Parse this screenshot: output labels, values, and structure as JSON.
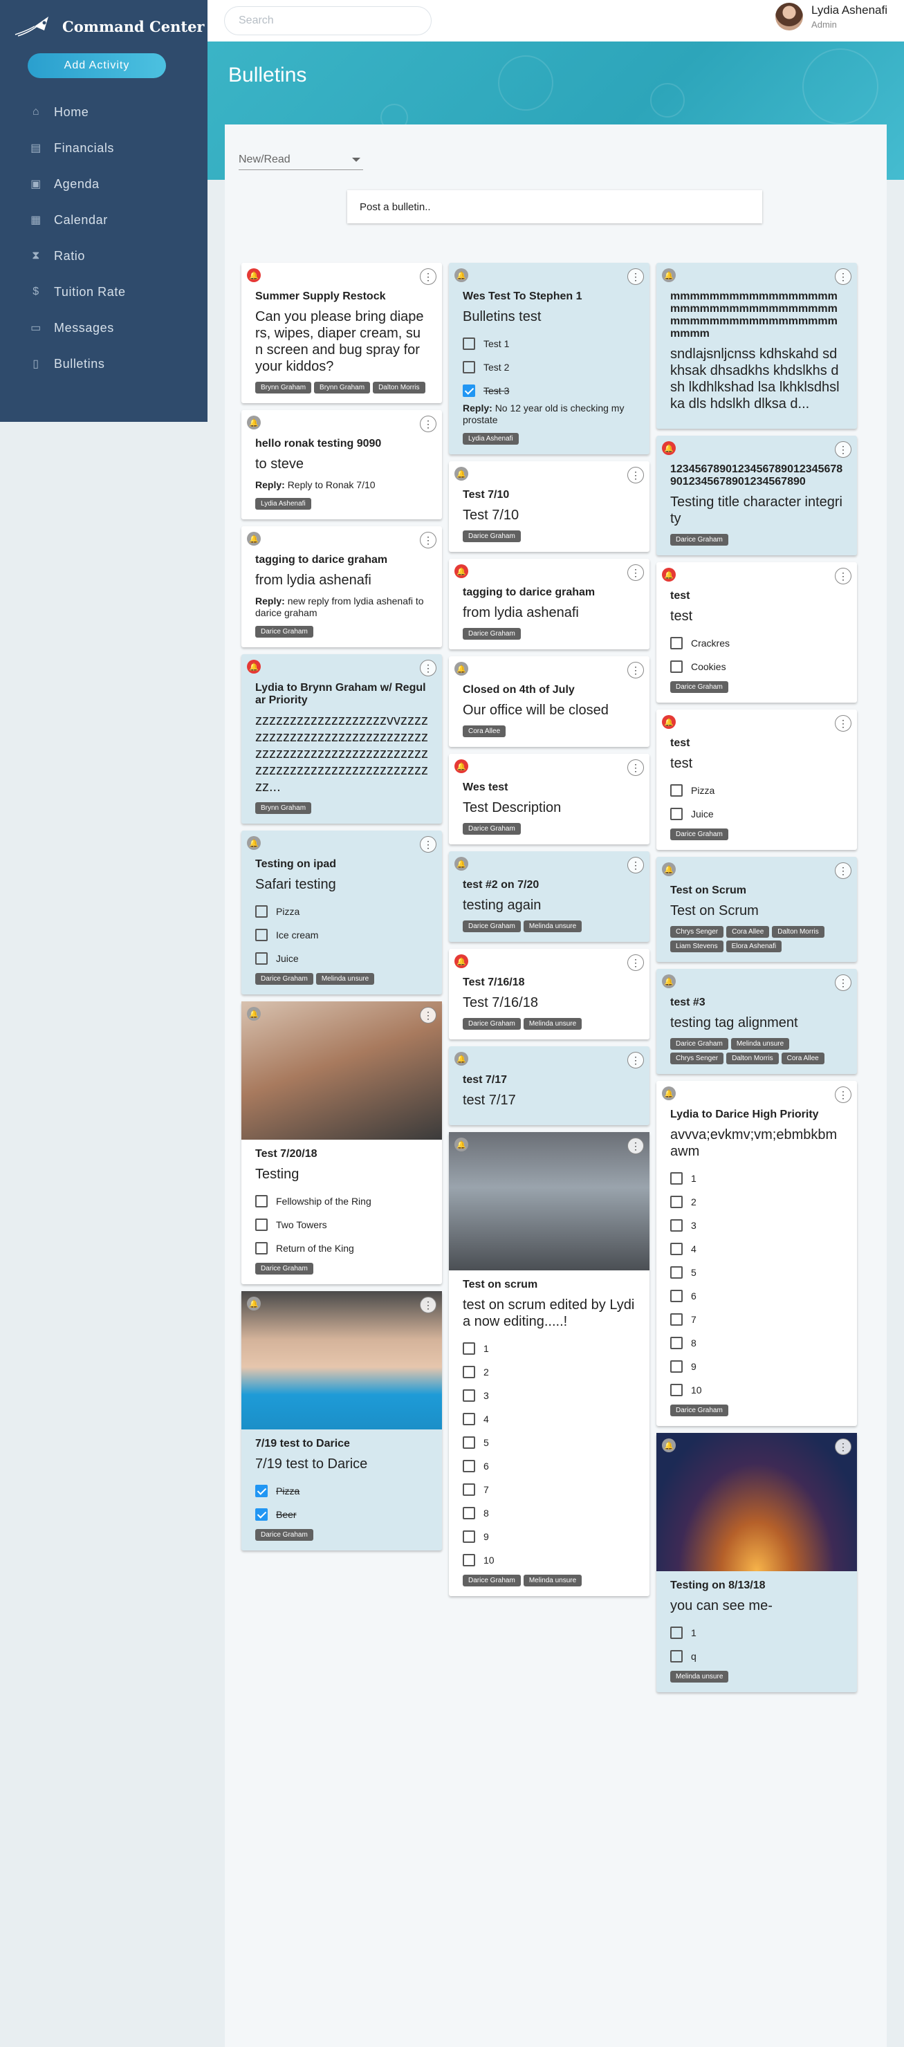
{
  "sidebar": {
    "brand": "Command Center",
    "add_activity": "Add Activity",
    "items": [
      {
        "label": "Home",
        "icon": "bank-icon"
      },
      {
        "label": "Financials",
        "icon": "chart-icon"
      },
      {
        "label": "Agenda",
        "icon": "camera-icon"
      },
      {
        "label": "Calendar",
        "icon": "calendar-icon"
      },
      {
        "label": "Ratio",
        "icon": "hourglass-icon"
      },
      {
        "label": "Tuition Rate",
        "icon": "dollar-icon"
      },
      {
        "label": "Messages",
        "icon": "message-icon"
      },
      {
        "label": "Bulletins",
        "icon": "document-icon"
      }
    ]
  },
  "topbar": {
    "search_placeholder": "Search",
    "user_name": "Lydia Ashenafi",
    "user_role": "Admin"
  },
  "page": {
    "title": "Bulletins",
    "filter": "New/Read",
    "post_placeholder": "Post a bulletin.."
  },
  "col1": [
    {
      "bell": "red",
      "title": "Summer Supply Restock",
      "desc": "Can you please bring diapers, wipes, diaper cream, sun screen and bug spray for your kiddos?",
      "tags": [
        "Brynn Graham",
        "Brynn Graham",
        "Dalton Morris"
      ]
    },
    {
      "bell": "grey",
      "title": "hello ronak testing 9090",
      "desc": "to steve",
      "reply_label": "Reply:",
      "reply": "Reply to Ronak 7/10",
      "tags": [
        "Lydia Ashenafi"
      ]
    },
    {
      "bell": "grey",
      "title": "tagging to darice graham",
      "desc": "from lydia ashenafi",
      "reply_label": "Reply:",
      "reply": "new reply from lydia ashenafi to darice graham",
      "tags": [
        "Darice Graham"
      ]
    },
    {
      "bell": "red",
      "blue": true,
      "title": "Lydia to Brynn Graham w/ Regular Priority",
      "desc": "zzzzzzzzzzzzzzzzzzzvvzzzzzzzzzzzzzzzzzzzzzzzzzzzzzzzzzzzzzzzzzzzzzzzzzzzzzzzzzzzzzzzzzzzzzzzzzzzzzzzzz...",
      "tags": [
        "Brynn Graham"
      ]
    },
    {
      "bell": "grey",
      "blue": true,
      "title": "Testing on ipad",
      "desc": "Safari testing",
      "checks": [
        {
          "t": "Pizza"
        },
        {
          "t": "Ice cream"
        },
        {
          "t": "Juice"
        }
      ],
      "tags": [
        "Darice Graham",
        "Melinda unsure"
      ]
    },
    {
      "bell": "grey",
      "photo": "selfie",
      "title": "Test 7/20/18",
      "desc": "Testing",
      "checks": [
        {
          "t": "Fellowship of the Ring"
        },
        {
          "t": "Two Towers"
        },
        {
          "t": "Return of the King"
        }
      ],
      "tags": [
        "Darice Graham"
      ]
    },
    {
      "bell": "grey",
      "photo": "girl",
      "blue": true,
      "title": "7/19 test to Darice",
      "desc": "7/19 test to Darice",
      "checks": [
        {
          "t": "Pizza",
          "on": true
        },
        {
          "t": "Beer",
          "on": true
        }
      ],
      "tags": [
        "Darice Graham"
      ]
    }
  ],
  "col2": [
    {
      "bell": "grey",
      "blue": true,
      "title": "Wes Test To Stephen 1",
      "desc": "Bulletins test",
      "checks": [
        {
          "t": "Test 1"
        },
        {
          "t": "Test 2"
        },
        {
          "t": "Test 3",
          "on": true
        }
      ],
      "reply_label": "Reply:",
      "reply": "No 12 year old is checking my prostate",
      "tags": [
        "Lydia Ashenafi"
      ]
    },
    {
      "bell": "grey",
      "title": "Test 7/10",
      "desc": "Test 7/10",
      "tags": [
        "Darice Graham"
      ]
    },
    {
      "bell": "red",
      "title": "tagging to darice graham",
      "desc": "from lydia ashenafi",
      "tags": [
        "Darice Graham"
      ]
    },
    {
      "bell": "grey",
      "title": "Closed on 4th of July",
      "desc": "Our office will be closed",
      "tags": [
        "Cora Allee"
      ]
    },
    {
      "bell": "red",
      "title": "Wes test",
      "desc": "Test Description",
      "tags": [
        "Darice Graham"
      ]
    },
    {
      "bell": "grey",
      "blue": true,
      "title": "test #2 on 7/20",
      "desc": "testing again",
      "tags": [
        "Darice Graham",
        "Melinda unsure"
      ]
    },
    {
      "bell": "red",
      "title": "Test 7/16/18",
      "desc": "Test 7/16/18",
      "tags": [
        "Darice Graham",
        "Melinda unsure"
      ]
    },
    {
      "bell": "grey",
      "blue": true,
      "title": "test 7/17",
      "desc": "test 7/17",
      "tags": []
    },
    {
      "bell": "grey",
      "photo": "crowd",
      "title": "Test on scrum",
      "desc": "test on scrum edited by Lydia now editing.....!",
      "checks": [
        {
          "t": "1"
        },
        {
          "t": "2"
        },
        {
          "t": "3"
        },
        {
          "t": "4"
        },
        {
          "t": "5"
        },
        {
          "t": "6"
        },
        {
          "t": "7"
        },
        {
          "t": "8"
        },
        {
          "t": "9"
        },
        {
          "t": "10"
        }
      ],
      "tags": [
        "Darice Graham",
        "Melinda unsure"
      ]
    }
  ],
  "col3": [
    {
      "bell": "grey",
      "blue": true,
      "title": "mmmmmmmmmmmmmmmmmmmmmmmmmmmmmmmmmmmmmmmmmmmmmmmmmmmmmmm",
      "desc": "sndlajsnljcnss kdhskahd sdkhsak dhsadkhs khdslkhs dsh lkdhlkshad lsa lkhklsdhslka dls hdslkh dlksa d...",
      "tags": []
    },
    {
      "bell": "red",
      "blue": true,
      "title": "12345678901234567890123456789012345678901234567890",
      "desc": "Testing title character integrity",
      "tags": [
        "Darice Graham"
      ]
    },
    {
      "bell": "red",
      "title": "test",
      "desc": "test",
      "checks": [
        {
          "t": "Crackres"
        },
        {
          "t": "Cookies"
        }
      ],
      "tags": [
        "Darice Graham"
      ]
    },
    {
      "bell": "red",
      "title": "test",
      "desc": "test",
      "checks": [
        {
          "t": "Pizza"
        },
        {
          "t": "Juice"
        }
      ],
      "tags": [
        "Darice Graham"
      ]
    },
    {
      "bell": "grey",
      "blue": true,
      "title": "Test on Scrum",
      "desc": "Test on Scrum",
      "tags": [
        "Chrys Senger",
        "Cora Allee",
        "Dalton Morris",
        "Liam Stevens",
        "Elora Ashenafi"
      ]
    },
    {
      "bell": "grey",
      "blue": true,
      "title": "test #3",
      "desc": "testing tag alignment",
      "tags": [
        "Darice Graham",
        "Melinda unsure",
        "Chrys Senger",
        "Dalton Morris",
        "Cora Allee"
      ]
    },
    {
      "bell": "grey",
      "title": "Lydia to Darice High Priority",
      "desc": "avvva;evkmv;vm;ebmbkbmawm",
      "checks": [
        {
          "t": "1"
        },
        {
          "t": "2"
        },
        {
          "t": "3"
        },
        {
          "t": "4"
        },
        {
          "t": "5"
        },
        {
          "t": "6"
        },
        {
          "t": "7"
        },
        {
          "t": "8"
        },
        {
          "t": "9"
        },
        {
          "t": "10"
        }
      ],
      "tags": [
        "Darice Graham"
      ]
    },
    {
      "bell": "grey",
      "photo": "city",
      "blue": true,
      "title": "Testing on 8/13/18",
      "desc": "you can see me-",
      "checks": [
        {
          "t": "1"
        },
        {
          "t": "q"
        }
      ],
      "tags": [
        "Melinda unsure"
      ]
    }
  ]
}
